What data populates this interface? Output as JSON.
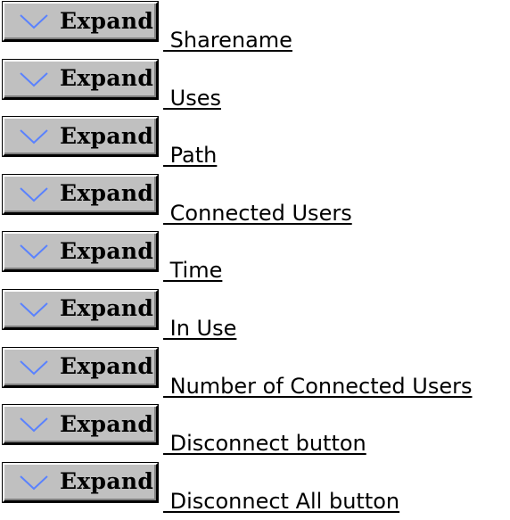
{
  "expand_label": "Expand",
  "icons": {
    "expand_chevron": "chevron-down-icon"
  },
  "colors": {
    "button_face": "#c0c0c0",
    "chevron": "#5a82ff",
    "text": "#000000",
    "background": "#ffffff"
  },
  "items": [
    {
      "label": " Sharename"
    },
    {
      "label": " Uses"
    },
    {
      "label": " Path"
    },
    {
      "label": " Connected Users"
    },
    {
      "label": " Time"
    },
    {
      "label": " In Use"
    },
    {
      "label": " Number of Connected Users"
    },
    {
      "label": " Disconnect button"
    },
    {
      "label": " Disconnect All button"
    }
  ]
}
